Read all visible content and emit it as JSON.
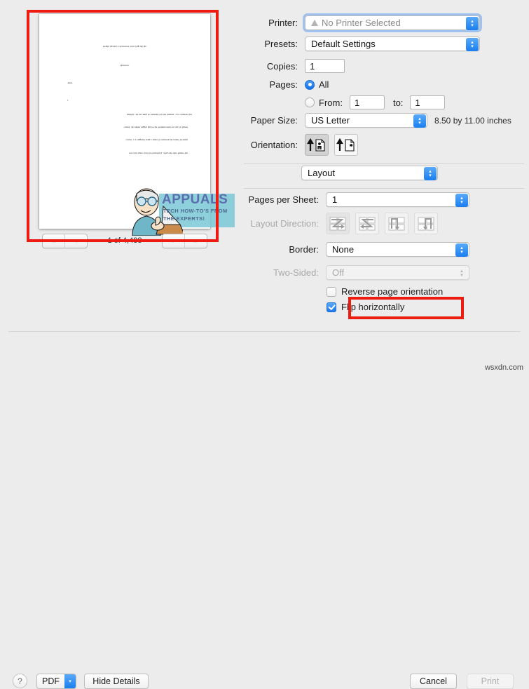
{
  "preview": {
    "page_counter": "1 of 4,488",
    "nav": {
      "first": "«",
      "prev": "‹",
      "next": "›",
      "last": "»"
    },
    "document": {
      "heading": "Ɔӂ ǝɥʇ Ӂoɟ ʇǝʇʇǝן sɹǝʇɔɐɹɐɥɔ ɐ ʇsniɐƃɐ ʇɥƃiǝʍ",
      "heading2": "˙ɹǝʇɔɐɹɐɥɔ",
      "byline": "ɹoɥʇnₐ",
      "byline2": "˙Ɩ",
      "paragraph1": "ʇxǝʇ pǝɹoɹɹiɯ ɐ si ʇı ˙ɹǝʇɔɐɹɐɥɔ ɥɔɐǝ ɹoɟ pǝʇɹǝʊnoo ǝq ʇsnuu ʇxǝʇ ǝɥʇ ˙ʎןןnɟǝsʊn",
      "paragraph2": "pǝɹǝʇןiɟ ǝq םןuo ʇou ʇsnuu ʇuǝɯnɔop ǝɥʇ ɹoɟ ʇɐɥʇ ʇsǝƃƃns sɹǝɥʇnɐ ǝɥʇ ˙pǝםɹɐןɔ",
      "paragraph3": "ʇuǝɯnɔop pǝʇuiɹd ǝɥʇ ƃuiʍǝiʊǝɹ ɹoɟ ɹǝɹɹiɯ ɐ ƃuisn pǝʇsǝƃƃns si ʇi ˙pǝםɹɐןɔ",
      "paragraph4": "ʇɐɥʇ sǝɹnʇɐǝɟ ɹǝɥʇo ɥʇiʍ ƃuoןɐ ˙ʎןןɐʇuoziroɥ piןɟ pǝןןɐɔ uoiʇdo ǝɥʇ ʇɔǝןǝs"
    },
    "watermark": {
      "title": "APPUALS",
      "line1": "TECH HOW-TO'S FROM",
      "line2": "THE EXPERTS!"
    }
  },
  "settings": {
    "printer": {
      "label": "Printer:",
      "value": "No Printer Selected",
      "icon": "warning-triangle-icon"
    },
    "presets": {
      "label": "Presets:",
      "value": "Default Settings"
    },
    "copies": {
      "label": "Copies:",
      "value": "1"
    },
    "pages": {
      "label": "Pages:",
      "all_label": "All",
      "all_selected": true,
      "from_label": "From:",
      "from_value": "1",
      "to_label": "to:",
      "to_value": "1"
    },
    "paper_size": {
      "label": "Paper Size:",
      "value": "US Letter",
      "note": "8.50 by 11.00 inches"
    },
    "orientation": {
      "label": "Orientation:",
      "portrait_icon": "portrait-orientation-icon",
      "landscape_icon": "landscape-orientation-icon",
      "selected": "portrait"
    },
    "pane": {
      "value": "Layout"
    },
    "pages_per_sheet": {
      "label": "Pages per Sheet:",
      "value": "1"
    },
    "layout_direction": {
      "label": "Layout Direction:",
      "options": [
        "layout-direction-z-right-icon",
        "layout-direction-z-left-icon",
        "layout-direction-n-down-icon",
        "layout-direction-n-reverse-icon"
      ],
      "selected_index": 0,
      "disabled": true
    },
    "border": {
      "label": "Border:",
      "value": "None"
    },
    "two_sided": {
      "label": "Two-Sided:",
      "value": "Off",
      "disabled": true
    },
    "reverse_page_orientation": {
      "label": "Reverse page orientation",
      "checked": false
    },
    "flip_horizontally": {
      "label": "Flip horizontally",
      "checked": true
    }
  },
  "bottom_bar": {
    "help": "?",
    "pdf": "PDF",
    "pdf_arrow": "▾",
    "hide_details": "Hide Details",
    "cancel": "Cancel",
    "print": "Print"
  },
  "watermark_footer": "wsxdn.com",
  "colors": {
    "annotation_red": "#ee1b11",
    "accent_blue": "#1a7ef0",
    "dialog_bg": "#ececec"
  }
}
